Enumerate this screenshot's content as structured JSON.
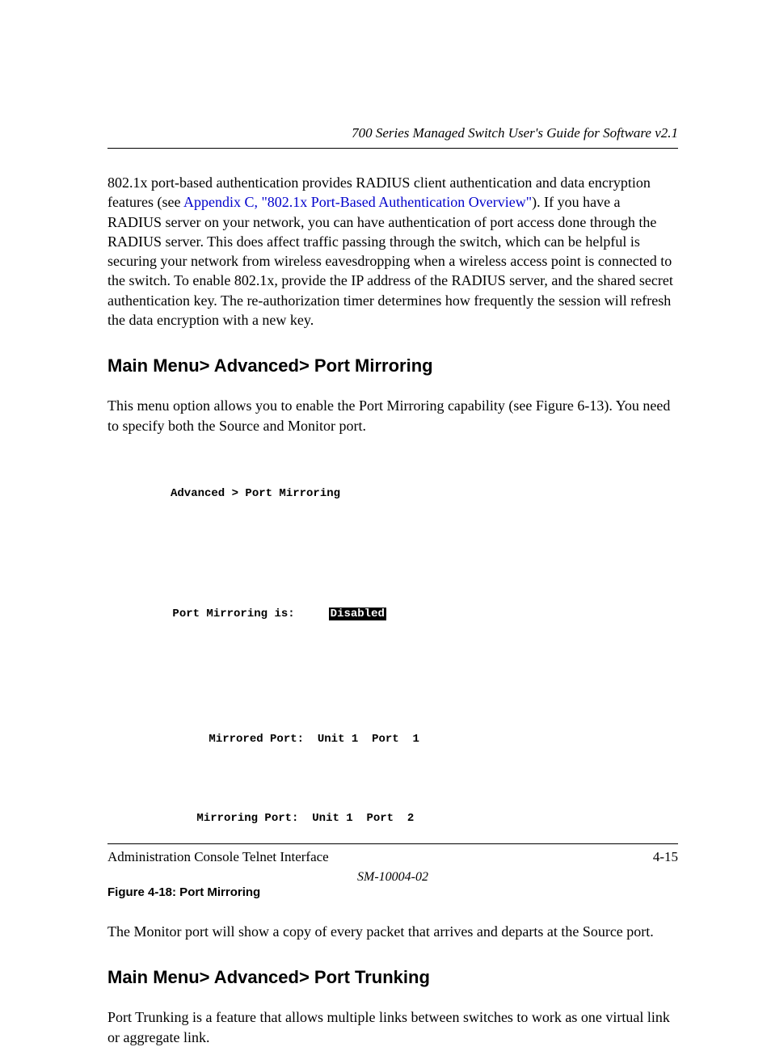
{
  "header": {
    "title": "700 Series Managed Switch User's Guide for Software v2.1"
  },
  "paragraphs": {
    "p1_before_link": "802.1x port-based authentication provides RADIUS client authentication and data encryption features (see ",
    "p1_link": "Appendix C, \"802.1x Port-Based Authentication Overview\"",
    "p1_after_link": ").  If you have a RADIUS server on your network, you can have authentication of port access done through the RADIUS server. This does affect traffic passing through the switch, which can be helpful is securing your network from wireless eavesdropping when a wireless access point is connected to the switch. To enable 802.1x, provide the IP address of the RADIUS server, and the shared secret authentication key. The re-authorization timer determines how frequently the session will refresh the data encryption with a new key.",
    "p2": "This menu option allows you to enable the Port Mirroring capability (see Figure 6-13). You need to specify both the Source and Monitor port.",
    "p3": "The Monitor port will show a copy of every packet that arrives and departs at the Source port.",
    "p4": "Port Trunking is a feature that allows multiple links between switches to work as one virtual link or aggregate link."
  },
  "headings": {
    "h1": "Main Menu> Advanced> Port Mirroring",
    "h2": "Main Menu> Advanced> Port Trunking"
  },
  "console": {
    "breadcrumb": "Advanced > Port Mirroring",
    "status_label": "Port Mirroring is:",
    "status_value": "Disabled",
    "mirrored_label": "Mirrored Port:",
    "mirrored_value": "Unit 1  Port  1",
    "mirroring_label": "Mirroring Port:",
    "mirroring_value": "Unit 1  Port  2"
  },
  "figure": {
    "caption": "Figure 4-18:  Port Mirroring"
  },
  "footer": {
    "left": "Administration Console Telnet Interface",
    "right": "4-15",
    "docnum": "SM-10004-02"
  }
}
